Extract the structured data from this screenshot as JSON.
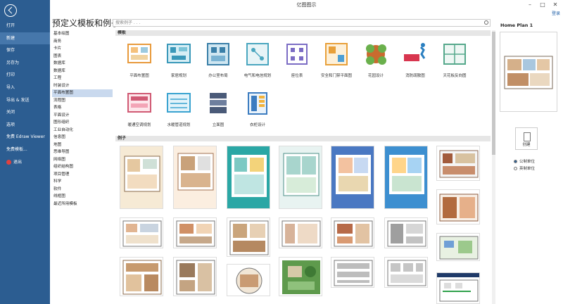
{
  "window": {
    "title": "亿图图示",
    "login": "登录"
  },
  "nav": {
    "items": [
      {
        "label": "打开"
      },
      {
        "label": "新建"
      },
      {
        "label": "保存"
      },
      {
        "label": "另存为"
      },
      {
        "label": "打印"
      },
      {
        "label": "导入"
      },
      {
        "label": "导出 & 发送"
      },
      {
        "label": "关闭"
      },
      {
        "label": "选项"
      },
      {
        "label": "免费 Edraw Viewer"
      },
      {
        "label": "免费模板..."
      },
      {
        "label": "退出"
      }
    ]
  },
  "main": {
    "heading": "预定义模板和例子",
    "search_placeholder": "搜索例子 . . .",
    "categories": [
      "基本绘图",
      "商务",
      "卡片",
      "图表",
      "数据库",
      "数据库",
      "工程",
      "时装设计",
      "平面布置图",
      "流程图",
      "表格",
      "平面设计",
      "图形组织",
      "工业自动化",
      "信息图",
      "地图",
      "思维导图",
      "网络图",
      "组织结构图",
      "项目管理",
      "科学",
      "软件",
      "线框图",
      "最近所用模板"
    ],
    "templates_section": "模板",
    "templates": [
      "平面布置图",
      "家居规划",
      "办公室布局",
      "电气和电信规划",
      "座位表",
      "安全和门禁平面图",
      "花园设计",
      "消防疏散图",
      "天花板反向图",
      "暖通空调规划",
      "水暖管道规划",
      "立面图",
      "衣柜设计"
    ],
    "examples_section": "例子",
    "example_texts": {
      "e1_footer": "Insert Your Title Here",
      "e2_head": "Insert Your Title Here",
      "e4_head": "APARTMENTS FLOOR PLAN",
      "e5_head": "Apartment Floor Plan",
      "e5_foot": "Insert Your Title Here",
      "e6_head": "Condominium Design Apartment",
      "e14_head": "EVACUATION DIAGRAM"
    }
  },
  "preview": {
    "title": "Home Plan 1",
    "create_label": "创建",
    "units": [
      {
        "label": "公制单位",
        "selected": true
      },
      {
        "label": "英制单位",
        "selected": false
      }
    ]
  },
  "colors": {
    "nav": "#2c5d91",
    "nav_active": "#4677ab",
    "accent": "#1f5fa8"
  }
}
